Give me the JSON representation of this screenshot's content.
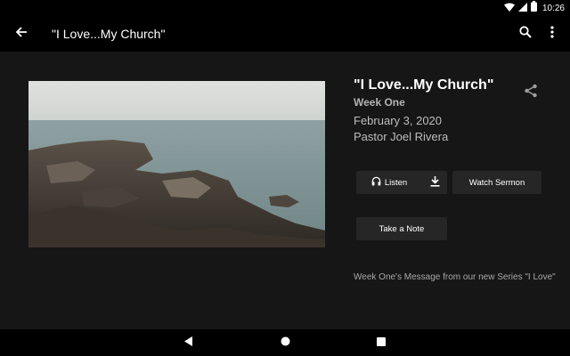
{
  "status_bar": {
    "time": "10:26",
    "icons": [
      "wifi-icon",
      "cell-signal-icon",
      "battery-icon"
    ]
  },
  "toolbar": {
    "title": "\"I Love...My Church\"",
    "icons": [
      "back-arrow-icon",
      "search-icon",
      "more-vert-icon"
    ]
  },
  "sermon": {
    "title": "\"I Love...My Church\"",
    "week": "Week One",
    "date": "February 3, 2020",
    "pastor": "Pastor Joel Rivera",
    "description": "Week One's Message from our new Series \"I Love\"",
    "image": "rocky-seashore-photo"
  },
  "actions": {
    "listen_label": "Listen",
    "watch_label": "Watch Sermon",
    "note_label": "Take a Note",
    "icons": [
      "headphones-icon",
      "download-icon",
      "share-icon"
    ]
  },
  "nav_bar": {
    "icons": [
      "nav-back-icon",
      "nav-home-icon",
      "nav-recents-icon"
    ]
  },
  "colors": {
    "background": "#161616",
    "bars": "#000000",
    "button": "#262626",
    "secondary_text": "#bdbdbd"
  }
}
